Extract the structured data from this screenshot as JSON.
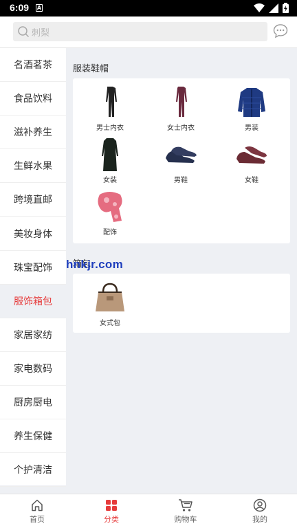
{
  "status": {
    "time": "6:09",
    "notif_glyph": "A"
  },
  "search": {
    "placeholder": "刺梨"
  },
  "sidebar": {
    "items": [
      {
        "label": "名酒茗茶"
      },
      {
        "label": "食品饮料"
      },
      {
        "label": "滋补养生"
      },
      {
        "label": "生鲜水果"
      },
      {
        "label": "跨境直邮"
      },
      {
        "label": "美妆身体"
      },
      {
        "label": "珠宝配饰"
      },
      {
        "label": "服饰箱包",
        "active": true
      },
      {
        "label": "家居家纺"
      },
      {
        "label": "家电数码"
      },
      {
        "label": "厨房厨电"
      },
      {
        "label": "养生保健"
      },
      {
        "label": "个护清洁"
      }
    ]
  },
  "sections": [
    {
      "title": "服装鞋帽",
      "products": [
        {
          "label": "男士内衣",
          "icon": "mens-underwear-icon"
        },
        {
          "label": "女士内衣",
          "icon": "womens-underwear-icon"
        },
        {
          "label": "男装",
          "icon": "mens-jacket-icon"
        },
        {
          "label": "女装",
          "icon": "womens-coat-icon"
        },
        {
          "label": "男鞋",
          "icon": "mens-shoes-icon"
        },
        {
          "label": "女鞋",
          "icon": "womens-shoes-icon"
        },
        {
          "label": "配饰",
          "icon": "scarf-icon"
        }
      ]
    },
    {
      "title": "箱包",
      "products": [
        {
          "label": "女式包",
          "icon": "handbag-icon"
        }
      ]
    }
  ],
  "watermark": "hnkjr.com",
  "tabbar": {
    "tabs": [
      {
        "label": "首页",
        "icon": "home-icon"
      },
      {
        "label": "分类",
        "icon": "category-grid-icon",
        "active": true
      },
      {
        "label": "购物车",
        "icon": "cart-icon"
      },
      {
        "label": "我的",
        "icon": "user-icon"
      }
    ]
  },
  "colors": {
    "accent": "#e63b3b",
    "background": "#eef0f4",
    "watermark": "#1f3fbd"
  }
}
